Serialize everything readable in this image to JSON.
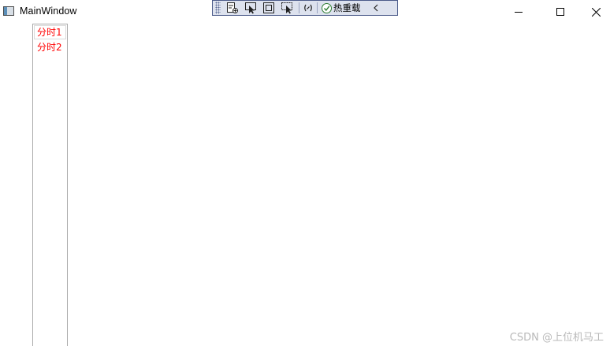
{
  "window": {
    "title": "MainWindow"
  },
  "debug_toolbar": {
    "hot_reload_label": "热重载"
  },
  "listbox": {
    "items": [
      {
        "label": "分时1",
        "color": "#ff0000",
        "selected": true
      },
      {
        "label": "分时2",
        "color": "#ff0000",
        "selected": false
      }
    ]
  },
  "watermark": "CSDN @上位机马工"
}
